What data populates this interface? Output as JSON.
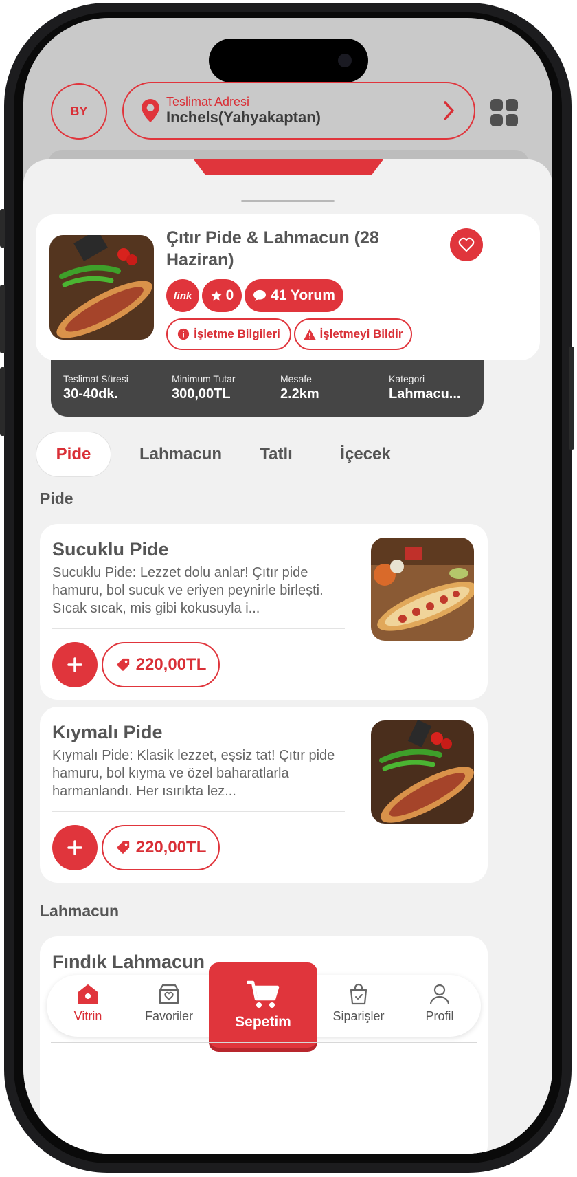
{
  "header": {
    "avatar_initials": "BY",
    "address_label": "Teslimat Adresi",
    "address_value": "Inchels(Yahyakaptan)"
  },
  "restaurant": {
    "name": "Çıtır Pide & Lahmacun (28 Haziran)",
    "fink_badge": "fink",
    "rating": "0",
    "reviews": "41 Yorum",
    "info_button": "İşletme Bilgileri",
    "report_button": "İşletmeyi Bildir"
  },
  "info_bar": [
    {
      "key": "Teslimat Süresi",
      "value": "30-40dk."
    },
    {
      "key": "Minimum Tutar",
      "value": "300,00TL"
    },
    {
      "key": "Mesafe",
      "value": "2.2km"
    },
    {
      "key": "Kategori",
      "value": "Lahmacu..."
    }
  ],
  "tabs": [
    "Pide",
    "Lahmacun",
    "Tatlı",
    "İçecek"
  ],
  "sections": [
    {
      "title": "Pide",
      "products": [
        {
          "name": "Sucuklu Pide",
          "description": "Sucuklu Pide: Lezzet dolu anlar! Çıtır pide hamuru, bol sucuk ve eriyen peynirle birleşti. Sıcak sıcak, mis gibi kokusuyla i...",
          "price": "220,00TL"
        },
        {
          "name": "Kıymalı Pide",
          "description": "Kıymalı Pide: Klasik lezzet, eşsiz tat! Çıtır pide hamuru, bol kıyma ve özel baharatlarla harmanlandı. Her ısırıkta lez...",
          "price": "220,00TL"
        }
      ]
    },
    {
      "title": "Lahmacun",
      "products": [
        {
          "name": "Fındık Lahmacun"
        }
      ]
    }
  ],
  "bottom_nav": {
    "home": "Vitrin",
    "favorites": "Favoriler",
    "cart": "Sepetim",
    "orders": "Siparişler",
    "profile": "Profil"
  },
  "colors": {
    "accent": "#e0353c",
    "dark_bar": "#454545",
    "text": "#555555"
  }
}
